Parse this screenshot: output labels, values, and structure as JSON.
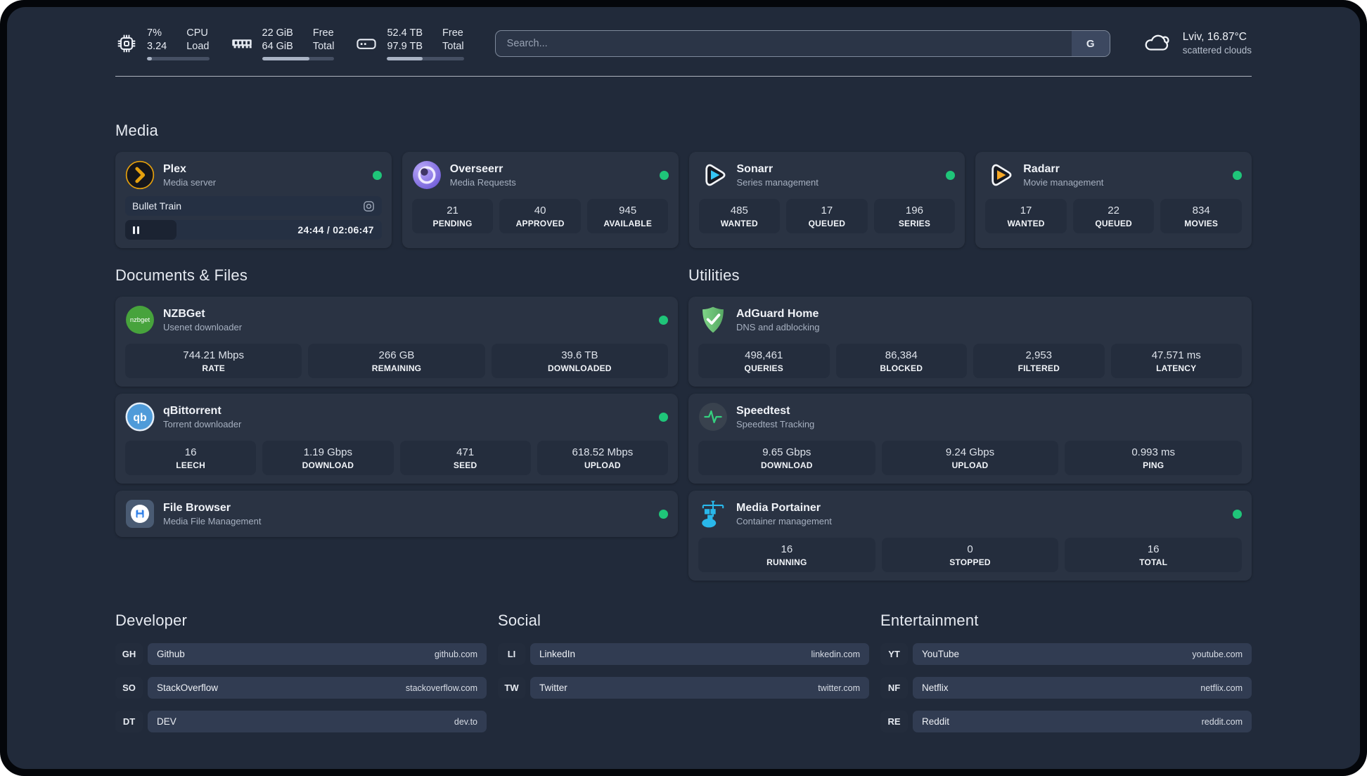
{
  "header": {
    "stats": [
      {
        "name": "cpu",
        "top_value": "7%",
        "bottom_value": "3.24",
        "top_label": "CPU",
        "bottom_label": "Load",
        "progress_pct": 8
      },
      {
        "name": "memory",
        "top_value": "22 GiB",
        "bottom_value": "64 GiB",
        "top_label": "Free",
        "bottom_label": "Total",
        "progress_pct": 66
      },
      {
        "name": "storage",
        "top_value": "52.4 TB",
        "bottom_value": "97.9 TB",
        "top_label": "Free",
        "bottom_label": "Total",
        "progress_pct": 46
      }
    ],
    "search": {
      "placeholder": "Search...",
      "button_label": "G"
    },
    "weather": {
      "title": "Lviv, 16.87°C",
      "subtitle": "scattered clouds"
    }
  },
  "sections": {
    "media": {
      "title": "Media",
      "plex": {
        "title": "Plex",
        "subtitle": "Media server",
        "online": true,
        "now_playing": {
          "title": "Bullet Train",
          "time_display": "24:44 / 02:06:47",
          "progress_pct": 20
        }
      },
      "overseerr": {
        "title": "Overseerr",
        "subtitle": "Media Requests",
        "online": true,
        "stats": [
          {
            "value": "21",
            "label": "PENDING"
          },
          {
            "value": "40",
            "label": "APPROVED"
          },
          {
            "value": "945",
            "label": "AVAILABLE"
          }
        ]
      },
      "sonarr": {
        "title": "Sonarr",
        "subtitle": "Series management",
        "online": true,
        "stats": [
          {
            "value": "485",
            "label": "WANTED"
          },
          {
            "value": "17",
            "label": "QUEUED"
          },
          {
            "value": "196",
            "label": "SERIES"
          }
        ]
      },
      "radarr": {
        "title": "Radarr",
        "subtitle": "Movie management",
        "online": true,
        "stats": [
          {
            "value": "17",
            "label": "WANTED"
          },
          {
            "value": "22",
            "label": "QUEUED"
          },
          {
            "value": "834",
            "label": "MOVIES"
          }
        ]
      }
    },
    "documents": {
      "title": "Documents & Files",
      "nzbget": {
        "title": "NZBGet",
        "subtitle": "Usenet downloader",
        "online": true,
        "stats": [
          {
            "value": "744.21 Mbps",
            "label": "RATE"
          },
          {
            "value": "266 GB",
            "label": "REMAINING"
          },
          {
            "value": "39.6 TB",
            "label": "DOWNLOADED"
          }
        ]
      },
      "qbittorrent": {
        "title": "qBittorrent",
        "subtitle": "Torrent downloader",
        "online": true,
        "stats": [
          {
            "value": "16",
            "label": "LEECH"
          },
          {
            "value": "1.19 Gbps",
            "label": "DOWNLOAD"
          },
          {
            "value": "471",
            "label": "SEED"
          },
          {
            "value": "618.52 Mbps",
            "label": "UPLOAD"
          }
        ]
      },
      "filebrowser": {
        "title": "File Browser",
        "subtitle": "Media File Management",
        "online": true
      }
    },
    "utilities": {
      "title": "Utilities",
      "adguard": {
        "title": "AdGuard Home",
        "subtitle": "DNS and adblocking",
        "stats": [
          {
            "value": "498,461",
            "label": "QUERIES"
          },
          {
            "value": "86,384",
            "label": "BLOCKED"
          },
          {
            "value": "2,953",
            "label": "FILTERED"
          },
          {
            "value": "47.571 ms",
            "label": "LATENCY"
          }
        ]
      },
      "speedtest": {
        "title": "Speedtest",
        "subtitle": "Speedtest Tracking",
        "stats": [
          {
            "value": "9.65 Gbps",
            "label": "DOWNLOAD"
          },
          {
            "value": "9.24 Gbps",
            "label": "UPLOAD"
          },
          {
            "value": "0.993 ms",
            "label": "PING"
          }
        ]
      },
      "portainer": {
        "title": "Media Portainer",
        "subtitle": "Container management",
        "online": true,
        "stats": [
          {
            "value": "16",
            "label": "RUNNING"
          },
          {
            "value": "0",
            "label": "STOPPED"
          },
          {
            "value": "16",
            "label": "TOTAL"
          }
        ]
      }
    },
    "developer": {
      "title": "Developer",
      "links": [
        {
          "tag": "GH",
          "name": "Github",
          "url": "github.com"
        },
        {
          "tag": "SO",
          "name": "StackOverflow",
          "url": "stackoverflow.com"
        },
        {
          "tag": "DT",
          "name": "DEV",
          "url": "dev.to"
        }
      ]
    },
    "social": {
      "title": "Social",
      "links": [
        {
          "tag": "LI",
          "name": "LinkedIn",
          "url": "linkedin.com"
        },
        {
          "tag": "TW",
          "name": "Twitter",
          "url": "twitter.com"
        }
      ]
    },
    "entertainment": {
      "title": "Entertainment",
      "links": [
        {
          "tag": "YT",
          "name": "YouTube",
          "url": "youtube.com"
        },
        {
          "tag": "NF",
          "name": "Netflix",
          "url": "netflix.com"
        },
        {
          "tag": "RE",
          "name": "Reddit",
          "url": "reddit.com"
        }
      ]
    }
  },
  "colors": {
    "page_bg": "#212a3a",
    "card_bg": "#2a3343",
    "tile_bg": "#242d3d",
    "accent_green": "#1fc579",
    "plex_amber": "#e5a00d",
    "sonarr_cyan": "#35c5f4",
    "radarr_amber": "#f7a825",
    "portainer_blue": "#29b8eb",
    "adguard_green": "#68bc71",
    "nzbget_green": "#47a33c",
    "qbittorrent_blue": "#4f9bd9",
    "overseerr_purple": "#8a76e8"
  }
}
